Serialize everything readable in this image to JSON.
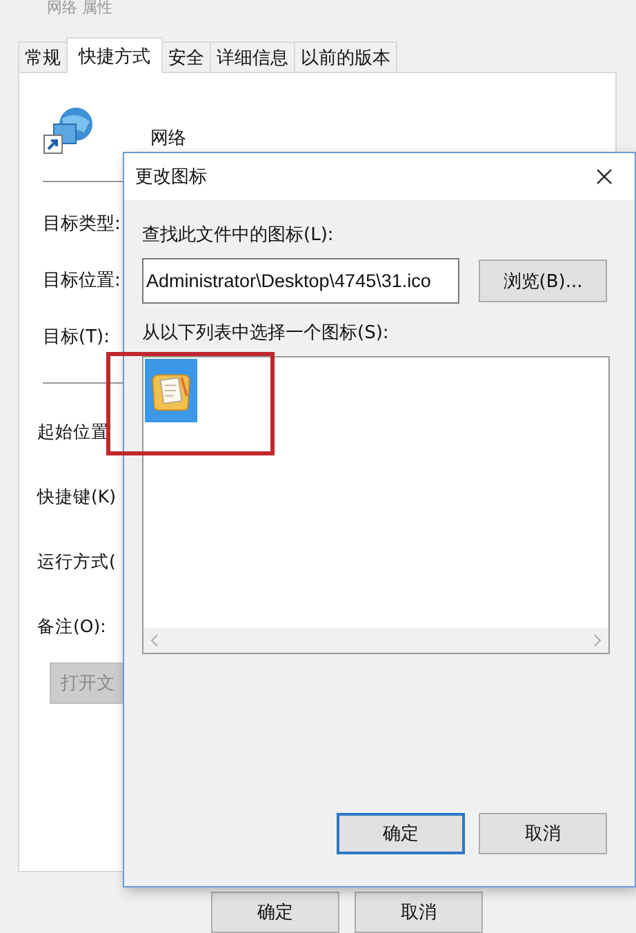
{
  "main_window": {
    "title": "网络 属性",
    "tabs": [
      {
        "label": "常规",
        "selected": false
      },
      {
        "label": "快捷方式",
        "selected": true
      },
      {
        "label": "安全",
        "selected": false
      },
      {
        "label": "详细信息",
        "selected": false
      },
      {
        "label": "以前的版本",
        "selected": false
      }
    ],
    "name": "网络",
    "fields_top": [
      "目标类型:",
      "目标位置:",
      "目标(T):"
    ],
    "fields_bottom": [
      "起始位置",
      "快捷键(K)",
      "运行方式(",
      "备注(O):"
    ],
    "open_button": {
      "label": "打开文",
      "disabled": true
    },
    "buttons": [
      "确定",
      "取消"
    ]
  },
  "dialog": {
    "title": "更改图标",
    "file_label": "查找此文件中的图标(L):",
    "file_path": "Administrator\\Desktop\\4745\\31.ico",
    "browse_button": "浏览(B)...",
    "list_label": "从以下列表中选择一个图标(S):",
    "icons": [
      {
        "selected": true
      }
    ],
    "ok_button": "确定",
    "cancel_button": "取消"
  }
}
